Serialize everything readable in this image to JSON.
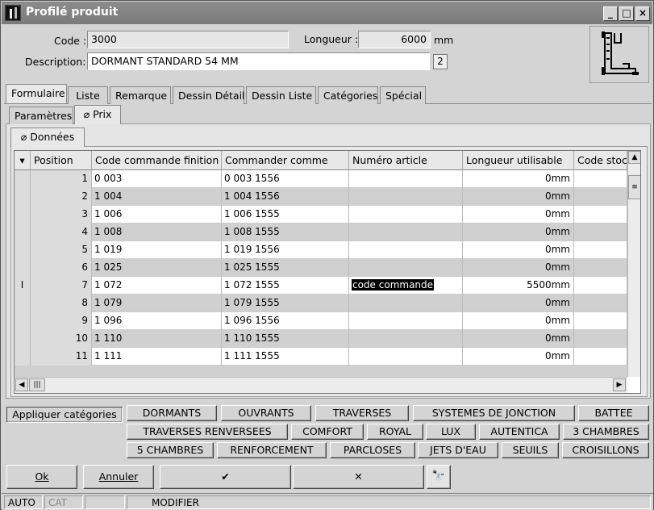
{
  "window": {
    "title": "Profilé produit"
  },
  "form": {
    "code_label": "Code :",
    "code_value": "3000",
    "length_label": "Longueur :",
    "length_value": "6000",
    "length_unit": "mm",
    "description_label": "Description:",
    "description_value": "DORMANT STANDARD 54 MM",
    "badge": "2"
  },
  "main_tabs": [
    "Formulaire",
    "Liste",
    "Remarque",
    "Dessin Détail",
    "Dessin Liste",
    "Catégories",
    "Spécial"
  ],
  "sub_tabs": [
    "Paramètres",
    "Prix"
  ],
  "inner_tab": "Données",
  "table": {
    "columns": [
      "Position",
      "Code commande finition",
      "Commander comme",
      "Numéro article",
      "Longueur utilisable",
      "Code stoc"
    ],
    "rows": [
      {
        "pos": "1",
        "code": "0 003",
        "commander": "0 003 1556",
        "article": "",
        "longueur": "0mm"
      },
      {
        "pos": "2",
        "code": "1 004",
        "commander": "1 004 1556",
        "article": "",
        "longueur": "0mm"
      },
      {
        "pos": "3",
        "code": "1 006",
        "commander": "1 006 1555",
        "article": "",
        "longueur": "0mm"
      },
      {
        "pos": "4",
        "code": "1 008",
        "commander": "1 008 1555",
        "article": "",
        "longueur": "0mm"
      },
      {
        "pos": "5",
        "code": "1 019",
        "commander": "1 019 1556",
        "article": "",
        "longueur": "0mm"
      },
      {
        "pos": "6",
        "code": "1 025",
        "commander": "1 025 1555",
        "article": "",
        "longueur": "0mm"
      },
      {
        "pos": "7",
        "code": "1 072",
        "commander": "1 072 1555",
        "article": "code commande",
        "longueur": "5500mm"
      },
      {
        "pos": "8",
        "code": "1 079",
        "commander": "1 079 1555",
        "article": "",
        "longueur": "0mm"
      },
      {
        "pos": "9",
        "code": "1 096",
        "commander": "1 096 1556",
        "article": "",
        "longueur": "0mm"
      },
      {
        "pos": "10",
        "code": "1 110",
        "commander": "1 110 1555",
        "article": "",
        "longueur": "0mm"
      },
      {
        "pos": "11",
        "code": "1 111",
        "commander": "1 111 1555",
        "article": "",
        "longueur": "0mm"
      }
    ],
    "cursor_glyph": "I"
  },
  "categories": {
    "apply_label": "Appliquer catégories",
    "row1": [
      "DORMANTS",
      "OUVRANTS",
      "TRAVERSES",
      "SYSTEMES DE JONCTION",
      "BATTEE"
    ],
    "row2": [
      "TRAVERSES RENVERSEES",
      "COMFORT",
      "ROYAL",
      "LUX",
      "AUTENTICA",
      "3 CHAMBRES"
    ],
    "row3": [
      "5 CHAMBRES",
      "RENFORCEMENT",
      "PARCLOSES",
      "JETS D'EAU",
      "SEUILS",
      "CROISILLONS"
    ]
  },
  "actions": {
    "ok": "Ok",
    "cancel": "Annuler",
    "check": "✔",
    "cross": "✕",
    "binoculars": "🔭"
  },
  "status": {
    "mode1": "AUTO",
    "mode2": "CAT",
    "mode3": "MODIFIER"
  }
}
